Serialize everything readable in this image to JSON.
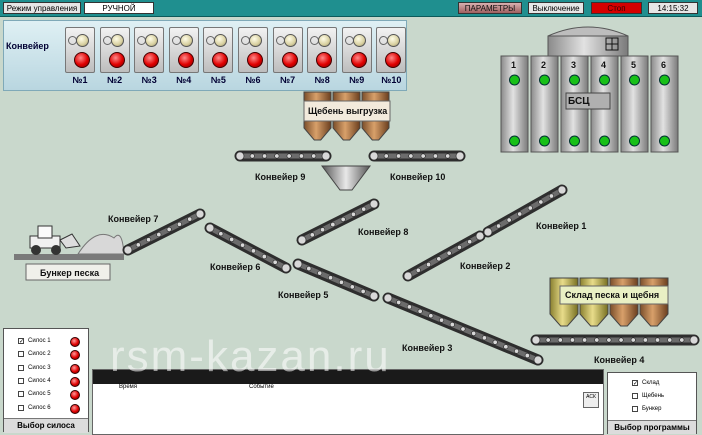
{
  "topbar": {
    "mode_label": "Режим управления",
    "mode_value": "РУЧНОЙ",
    "params_label": "ПАРАМЕТРЫ",
    "off_label": "Выключение",
    "stop_label": "Стоп",
    "clock": "14:15:32"
  },
  "conveyors_panel": {
    "title": "Конвейер",
    "buttons": [
      "№1",
      "№2",
      "№3",
      "№4",
      "№5",
      "№6",
      "№7",
      "№8",
      "№9",
      "№10"
    ]
  },
  "plant": {
    "bsc_label": "БСЦ",
    "silo_numbers": [
      "1",
      "2",
      "3",
      "4",
      "5",
      "6"
    ],
    "gravel_unload": "Щебень выгрузка",
    "sand_bunker": "Бункер песка",
    "sand_gravel_store": "Склад песка и щебня",
    "conveyor_labels": {
      "c1": "Конвейер 1",
      "c2": "Конвейер 2",
      "c3": "Конвейер 3",
      "c4": "Конвейер 4",
      "c5": "Конвейер 5",
      "c6": "Конвейер 6",
      "c7": "Конвейер 7",
      "c8": "Конвейер 8",
      "c9": "Конвейер 9",
      "c10": "Конвейер 10"
    }
  },
  "silo_select": {
    "title": "Выбор силоса",
    "items": [
      "Силос 1",
      "Силос 2",
      "Силос 3",
      "Силос 4",
      "Силос 5",
      "Силос 6"
    ],
    "checked": [
      true,
      false,
      false,
      false,
      false,
      false
    ]
  },
  "event_log": {
    "col_time": "Время",
    "col_event": "Событие",
    "ack_label": "АСК"
  },
  "program_select": {
    "title": "Выбор программы",
    "items": [
      "Склад",
      "Щебень",
      "Бункер"
    ],
    "checked": [
      true,
      false,
      false
    ]
  },
  "watermark": "rsm-kazan.ru",
  "colors": {
    "topbar": "#1f8f8f",
    "background": "#c9d8cc",
    "stop": "#d40000",
    "lamp_on": "#18c018",
    "lamp_off": "#e00000"
  }
}
